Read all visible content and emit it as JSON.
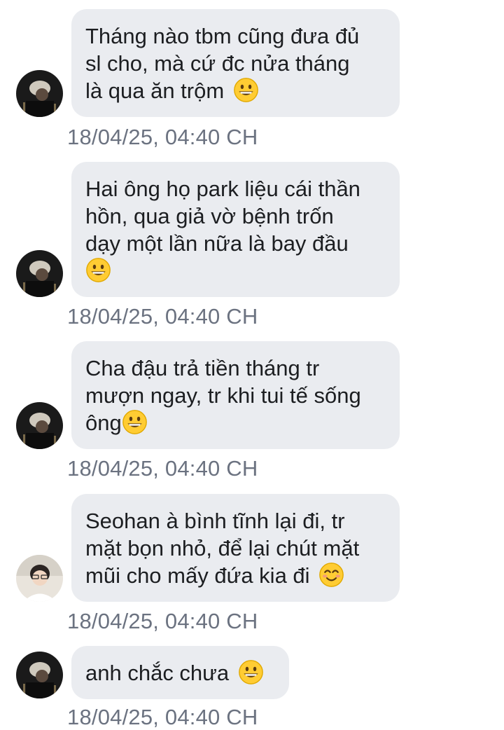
{
  "colors": {
    "bubble_bg": "#eaecf0",
    "text": "#1c1e21",
    "timestamp": "#6b7280",
    "emoji_face": "#ffcc33"
  },
  "messages": [
    {
      "avatar": "dark-avatar",
      "lines": [
        "Tháng nào tbm cũng đưa đủ",
        "sl cho, mà cứ đc nửa tháng",
        "là qua ăn trộm"
      ],
      "emoji": "grinning-face",
      "time": "18/04/25, 04:40 CH"
    },
    {
      "avatar": "dark-avatar",
      "lines": [
        "Hai ông họ park liệu cái thần",
        "hồn, qua giả vờ bệnh trốn",
        "dạy một lần nữa là bay đầu",
        ""
      ],
      "emoji": "grinning-face",
      "time": "18/04/25, 04:40 CH"
    },
    {
      "avatar": "dark-avatar",
      "lines": [
        "Cha đậu trả tiền tháng tr",
        "mượn ngay, tr khi tui tế sống",
        "ông"
      ],
      "emoji": "grinning-face",
      "time": "18/04/25, 04:40 CH"
    },
    {
      "avatar": "light-avatar",
      "lines": [
        "Seohan à bình tĩnh lại đi, tr",
        "mặt bọn nhỏ, để lại chút mặt",
        "mũi cho mấy đứa kia đi"
      ],
      "emoji": "smiling-face",
      "time": "18/04/25, 04:40 CH"
    },
    {
      "avatar": "dark-avatar",
      "lines": [
        "anh chắc chưa"
      ],
      "emoji": "grinning-face",
      "time": "18/04/25, 04:40 CH"
    }
  ]
}
